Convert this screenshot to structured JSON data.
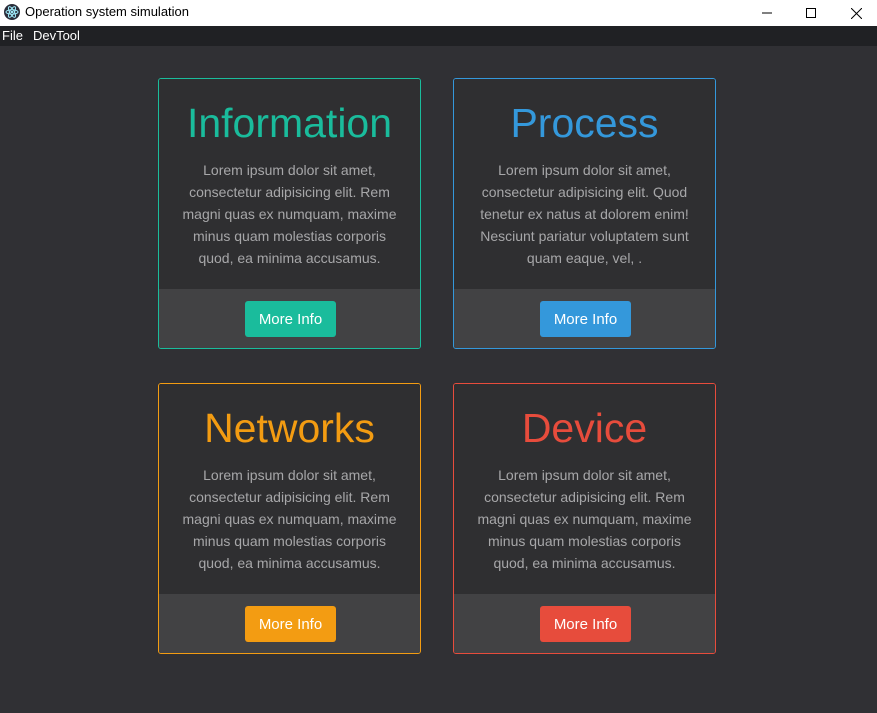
{
  "window": {
    "title": "Operation system simulation",
    "icons": {
      "app": "electron-icon",
      "minimize": "minimize-icon",
      "maximize": "maximize-icon",
      "close": "close-icon"
    }
  },
  "menu": {
    "items": [
      "File",
      "DevTool"
    ]
  },
  "cards": [
    {
      "title": "Information",
      "text": "Lorem ipsum dolor sit amet, consectetur adipisicing elit. Rem magni quas ex numquam, maxime minus quam molestias corporis quod, ea minima accusamus.",
      "button": "More Info",
      "color": "#1abc9c"
    },
    {
      "title": "Process",
      "text": "Lorem ipsum dolor sit amet, consectetur adipisicing elit. Quod tenetur ex natus at dolorem enim! Nesciunt pariatur voluptatem sunt quam eaque, vel, .",
      "button": "More Info",
      "color": "#3498db"
    },
    {
      "title": "Networks",
      "text": "Lorem ipsum dolor sit amet, consectetur adipisicing elit. Rem magni quas ex numquam, maxime minus quam molestias corporis quod, ea minima accusamus.",
      "button": "More Info",
      "color": "#f39c12"
    },
    {
      "title": "Device",
      "text": "Lorem ipsum dolor sit amet, consectetur adipisicing elit. Rem magni quas ex numquam, maxime minus quam molestias corporis quod, ea minima accusamus.",
      "button": "More Info",
      "color": "#e74c3c"
    }
  ],
  "colors": {
    "background": "#303034",
    "menubar": "#202124",
    "card_footer": "#424244"
  }
}
